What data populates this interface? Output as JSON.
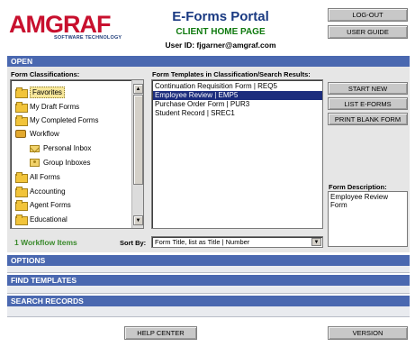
{
  "brand": {
    "logo_text": "AMGRAF",
    "logo_sub": "SOFTWARE TECHNOLOGY",
    "portal_title": "E-Forms Portal",
    "portal_subtitle": "CLIENT HOME PAGE",
    "user_id": "User ID: fjgarner@amgraf.com"
  },
  "header_buttons": {
    "logout": "LOG-OUT",
    "user_guide": "USER GUIDE"
  },
  "sections": {
    "open": "OPEN",
    "options": "OPTIONS",
    "find_templates": "FIND TEMPLATES",
    "search_records": "SEARCH RECORDS"
  },
  "classifications": {
    "label": "Form Classifications:",
    "items": [
      {
        "label": "Favorites",
        "icon": "folder-icon",
        "selected": true
      },
      {
        "label": "My Draft Forms",
        "icon": "folder-icon"
      },
      {
        "label": "My Completed Forms",
        "icon": "folder-icon"
      },
      {
        "label": "Workflow",
        "icon": "workflow-icon"
      },
      {
        "label": "Personal Inbox",
        "icon": "envelope-icon"
      },
      {
        "label": "Group Inboxes",
        "icon": "group-inbox-icon"
      },
      {
        "label": "All Forms",
        "icon": "folder-icon"
      },
      {
        "label": "Accounting",
        "icon": "folder-icon"
      },
      {
        "label": "Agent Forms",
        "icon": "folder-icon"
      },
      {
        "label": "Educational",
        "icon": "folder-icon"
      }
    ],
    "workflow_items": "1 Workflow Items"
  },
  "templates": {
    "label": "Form Templates in Classification/Search Results:",
    "rows": [
      {
        "label": "Continuation Requisition Form | REQ5"
      },
      {
        "label": "Employee Review | EMP5",
        "selected": true
      },
      {
        "label": "Purchase Order Form | PUR3"
      },
      {
        "label": "Student Record | SREC1"
      }
    ],
    "sort_label": "Sort By:",
    "sort_value": "Form Title, list as Title | Number"
  },
  "actions": {
    "start_new": "START NEW",
    "list_eforms": "LIST E-FORMS",
    "print_blank": "PRINT BLANK FORM"
  },
  "description": {
    "label": "Form Description:",
    "text": "Employee Review Form"
  },
  "footer": {
    "help_center": "HELP CENTER",
    "version": "VERSION"
  },
  "colors": {
    "brand_red": "#c8102e",
    "title_blue": "#1a3a82",
    "subtitle_green": "#0f7a0f",
    "section_bar": "#4a68b0",
    "selection_navy": "#1c2d7d"
  }
}
